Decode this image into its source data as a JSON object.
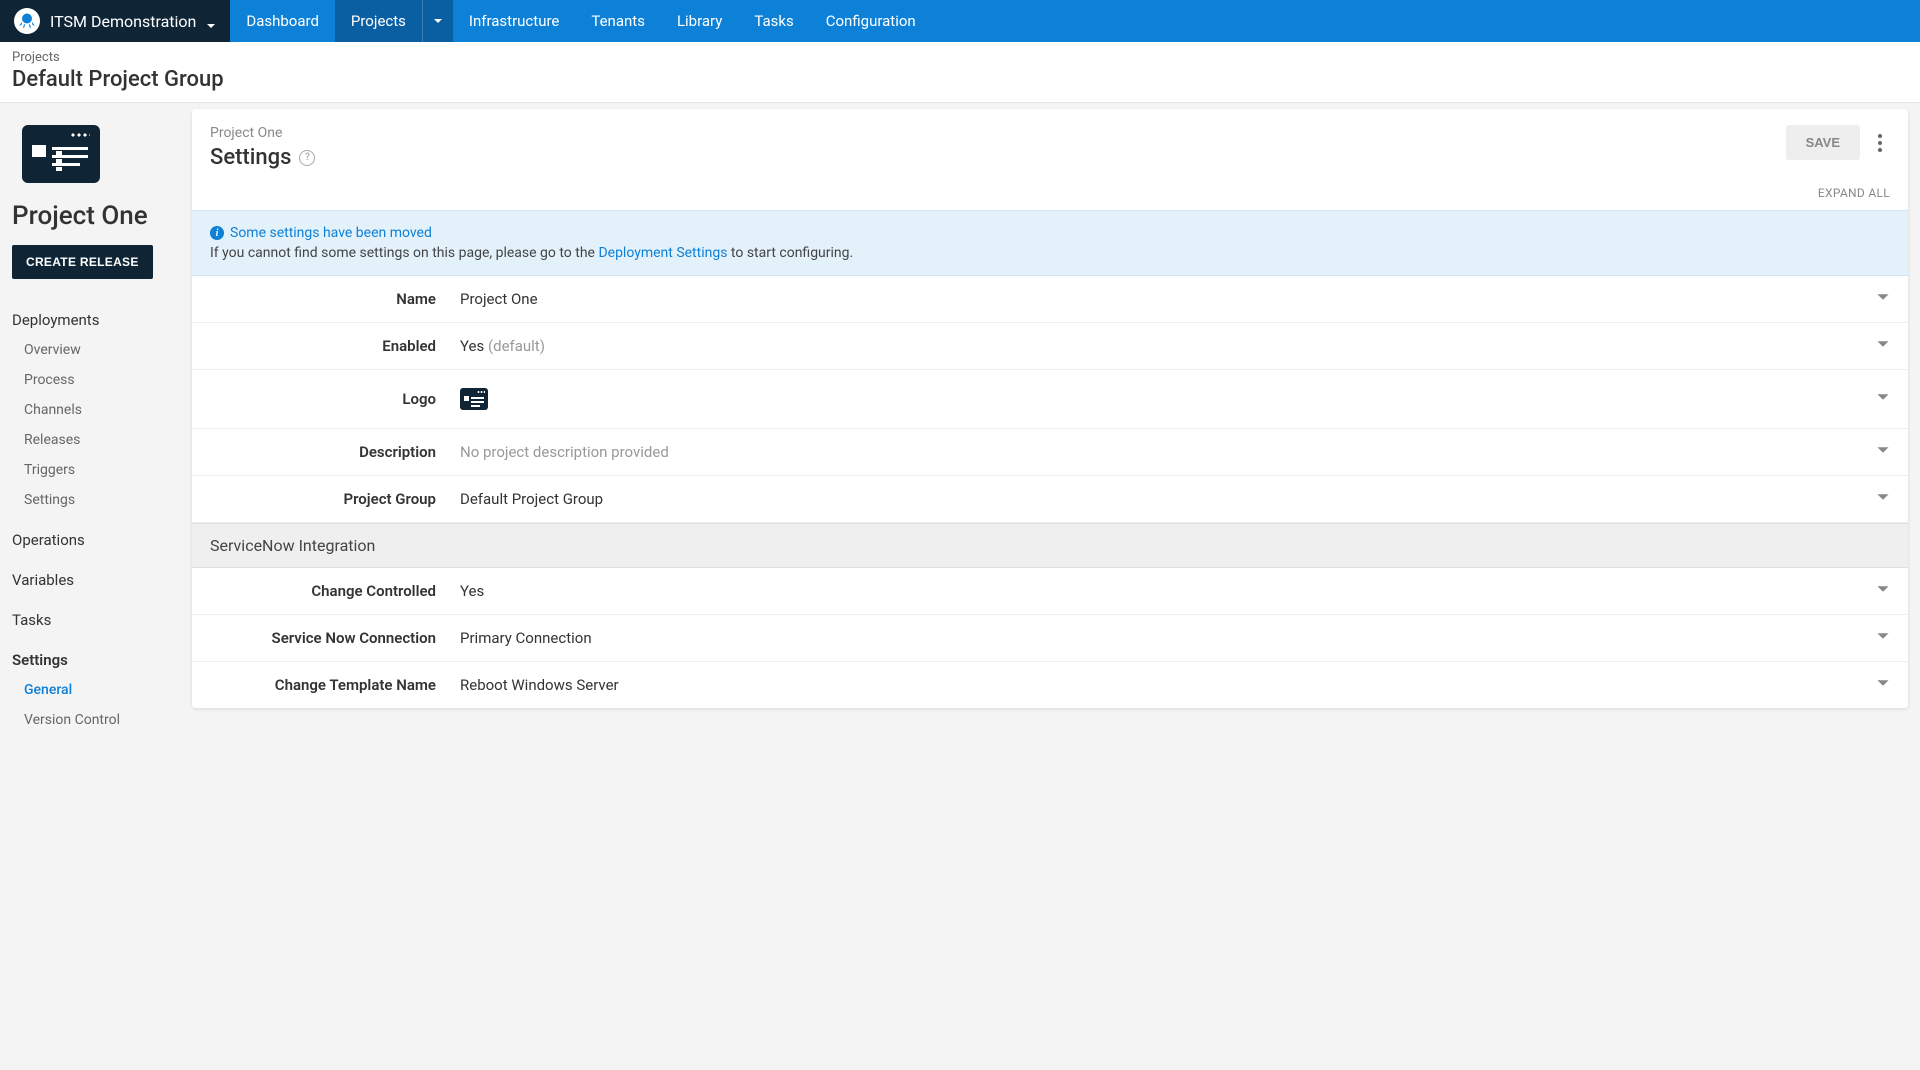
{
  "topnav": {
    "space": "ITSM Demonstration",
    "items": [
      "Dashboard",
      "Projects",
      "Infrastructure",
      "Tenants",
      "Library",
      "Tasks",
      "Configuration"
    ],
    "activeIndex": 1
  },
  "breadcrumb": {
    "crumb": "Projects",
    "title": "Default Project Group"
  },
  "sidebar": {
    "projectName": "Project One",
    "createRelease": "CREATE RELEASE",
    "sections": [
      {
        "heading": "Deployments",
        "items": [
          "Overview",
          "Process",
          "Channels",
          "Releases",
          "Triggers",
          "Settings"
        ]
      },
      {
        "heading": "Operations"
      },
      {
        "heading": "Variables"
      },
      {
        "heading": "Tasks"
      },
      {
        "heading": "Settings",
        "active": true,
        "items": [
          "General",
          "Version Control"
        ],
        "activeItem": "General"
      }
    ]
  },
  "page": {
    "projectLabel": "Project One",
    "title": "Settings",
    "saveLabel": "SAVE",
    "expandAll": "EXPAND ALL"
  },
  "alert": {
    "title": "Some settings have been moved",
    "bodyPrefix": "If you cannot find some settings on this page, please go to the ",
    "link": "Deployment Settings",
    "bodySuffix": " to start configuring."
  },
  "settings": [
    {
      "label": "Name",
      "value": "Project One"
    },
    {
      "label": "Enabled",
      "value": "Yes",
      "suffix": "(default)"
    },
    {
      "label": "Logo",
      "logo": true
    },
    {
      "label": "Description",
      "value": "No project description provided",
      "muted": true
    },
    {
      "label": "Project Group",
      "value": "Default Project Group"
    }
  ],
  "integrationSection": "ServiceNow Integration",
  "integrationSettings": [
    {
      "label": "Change Controlled",
      "value": "Yes"
    },
    {
      "label": "Service Now Connection",
      "value": "Primary Connection"
    },
    {
      "label": "Change Template Name",
      "value": "Reboot Windows Server"
    }
  ]
}
